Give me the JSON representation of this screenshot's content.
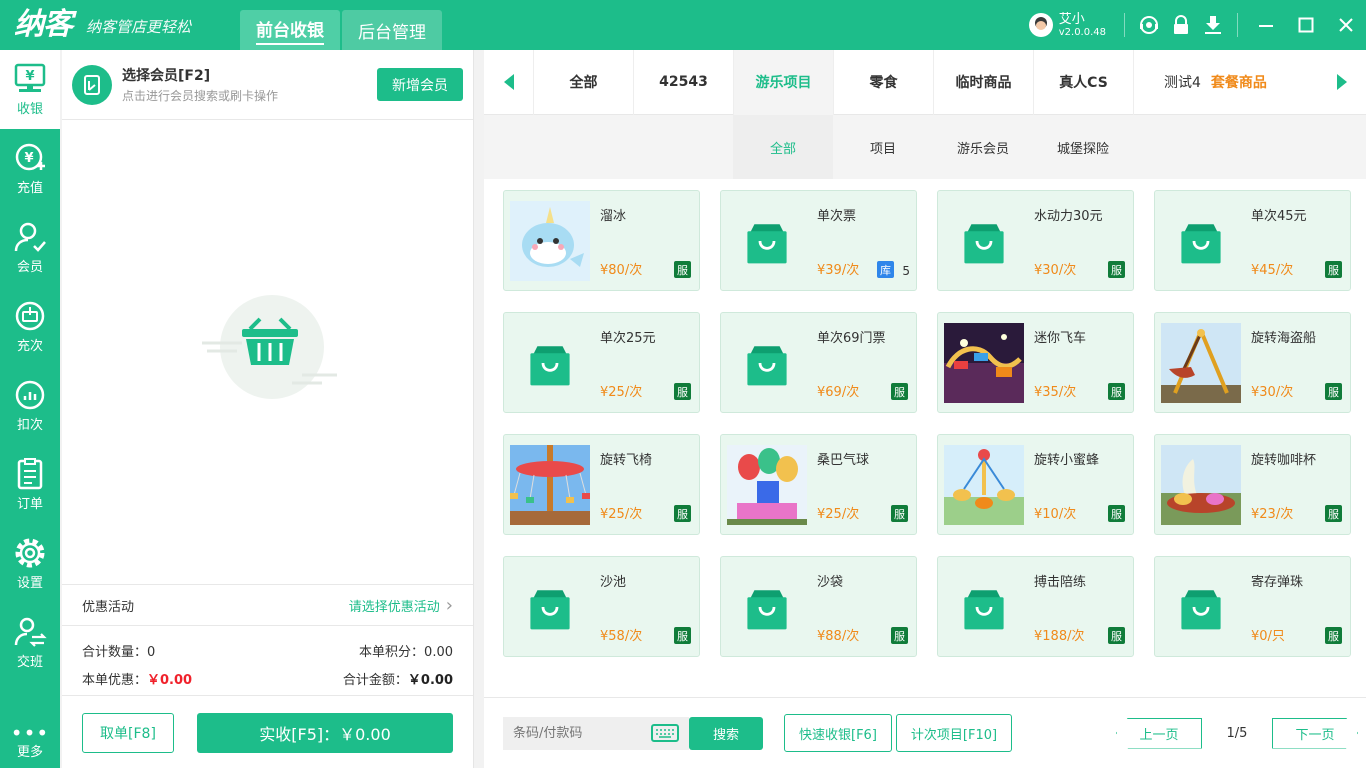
{
  "brand": {
    "logo": "纳客",
    "slogan": "纳客管店更轻松"
  },
  "top_tabs": [
    {
      "label": "前台收银"
    },
    {
      "label": "后台管理"
    }
  ],
  "user": {
    "name": "艾小",
    "version": "v2.0.0.48"
  },
  "sidenav": [
    {
      "label": "收银",
      "icon": "cashier-icon"
    },
    {
      "label": "充值",
      "icon": "recharge-icon"
    },
    {
      "label": "会员",
      "icon": "member-icon"
    },
    {
      "label": "充次",
      "icon": "charge-times-icon"
    },
    {
      "label": "扣次",
      "icon": "deduct-times-icon"
    },
    {
      "label": "订单",
      "icon": "order-icon"
    },
    {
      "label": "设置",
      "icon": "settings-icon"
    },
    {
      "label": "交班",
      "icon": "handover-icon"
    }
  ],
  "sidenav_more": "更多",
  "member": {
    "title": "选择会员[F2]",
    "subtitle": "点击进行会员搜索或刷卡操作",
    "add_button": "新增会员"
  },
  "promo": {
    "label": "优惠活动",
    "link": "请选择优惠活动"
  },
  "totals": {
    "qty_label": "合计数量：",
    "qty": "0",
    "points_label": "本单积分：",
    "points": "0.00",
    "discount_label": "本单优惠：",
    "discount": "￥0.00",
    "amount_label": "合计金额：",
    "amount": "￥0.00"
  },
  "cart_actions": {
    "cancel": "取单[F8]",
    "pay": "实收[F5]：￥0.00"
  },
  "categories": [
    "全部",
    "42543",
    "游乐项目",
    "零食",
    "临时商品",
    "真人CS",
    "测试4",
    "套餐商品"
  ],
  "subcategories": [
    "全部",
    "项目",
    "游乐会员",
    "城堡探险"
  ],
  "products": [
    {
      "name": "溜冰",
      "price": "¥80/次",
      "badge": "服",
      "img": "narwhal"
    },
    {
      "name": "单次票",
      "price": "¥39/次",
      "badge": "库",
      "stock": "5",
      "img": "bag"
    },
    {
      "name": "水动力30元",
      "price": "¥30/次",
      "badge": "服",
      "img": "bag"
    },
    {
      "name": "单次45元",
      "price": "¥45/次",
      "badge": "服",
      "img": "bag"
    },
    {
      "name": "单次25元",
      "price": "¥25/次",
      "badge": "服",
      "img": "bag"
    },
    {
      "name": "单次69门票",
      "price": "¥69/次",
      "badge": "服",
      "img": "bag"
    },
    {
      "name": "迷你飞车",
      "price": "¥35/次",
      "badge": "服",
      "img": "coaster"
    },
    {
      "name": "旋转海盗船",
      "price": "¥30/次",
      "badge": "服",
      "img": "pirate"
    },
    {
      "name": "旋转飞椅",
      "price": "¥25/次",
      "badge": "服",
      "img": "swing"
    },
    {
      "name": "桑巴气球",
      "price": "¥25/次",
      "badge": "服",
      "img": "balloon"
    },
    {
      "name": "旋转小蜜蜂",
      "price": "¥10/次",
      "badge": "服",
      "img": "bee"
    },
    {
      "name": "旋转咖啡杯",
      "price": "¥23/次",
      "badge": "服",
      "img": "cup"
    },
    {
      "name": "沙池",
      "price": "¥58/次",
      "badge": "服",
      "img": "bag"
    },
    {
      "name": "沙袋",
      "price": "¥88/次",
      "badge": "服",
      "img": "bag"
    },
    {
      "name": "搏击陪练",
      "price": "¥188/次",
      "badge": "服",
      "img": "bag"
    },
    {
      "name": "寄存弹珠",
      "price": "¥0/只",
      "badge": "服",
      "img": "bag"
    }
  ],
  "search": {
    "placeholder": "条码/付款码",
    "button": "搜索"
  },
  "functions": {
    "quick_pay": "快速收银[F6]",
    "count_item": "计次项目[F10]"
  },
  "pager": {
    "prev": "上一页",
    "next": "下一页",
    "page": "1/5"
  },
  "colors": {
    "accent": "#1dbd8a",
    "price": "#f08a1a",
    "badge": "#107c3a",
    "discount": "#f0212b"
  }
}
